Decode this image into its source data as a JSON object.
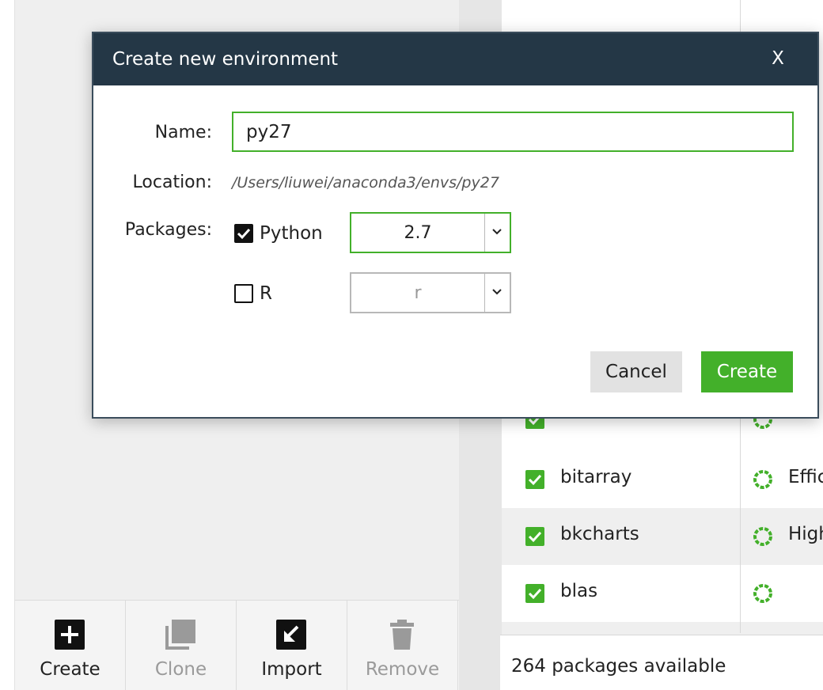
{
  "dialog": {
    "title": "Create new environment",
    "close_label": "X",
    "name_label": "Name:",
    "name_value": "py27",
    "location_label": "Location:",
    "location_value": "/Users/liuwei/anaconda3/envs/py27",
    "packages_label": "Packages:",
    "python": {
      "label": "Python",
      "checked": true,
      "version": "2.7"
    },
    "r": {
      "label": "R",
      "checked": false,
      "version": "r"
    },
    "cancel_label": "Cancel",
    "create_label": "Create"
  },
  "toolbar": {
    "create_label": "Create",
    "clone_label": "Clone",
    "import_label": "Import",
    "remove_label": "Remove"
  },
  "packages": {
    "rows": [
      {
        "name": "bitarray",
        "description": "Effic"
      },
      {
        "name": "bkcharts",
        "description": "High"
      },
      {
        "name": "blas",
        "description": ""
      }
    ],
    "count_text": "264 packages available"
  },
  "colors": {
    "accent_green": "#43b02a",
    "dialog_header": "#243746",
    "panel_gray": "#efefef"
  }
}
